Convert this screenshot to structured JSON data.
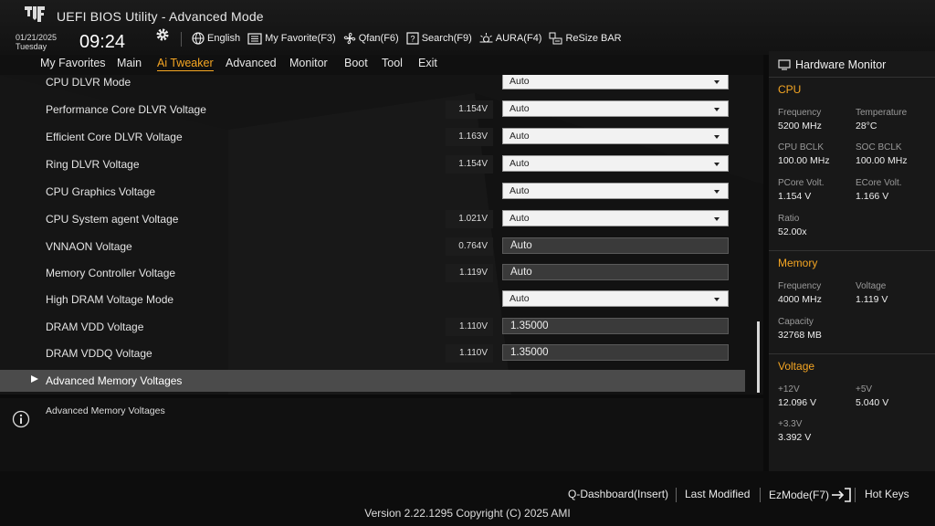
{
  "app": {
    "title": "UEFI BIOS Utility - Advanced Mode",
    "date": "01/21/2025",
    "day": "Tuesday",
    "time": "09:24"
  },
  "toolbar": [
    {
      "label": "English",
      "icon": "globe-icon"
    },
    {
      "label": "My Favorite(F3)",
      "icon": "favorite-icon"
    },
    {
      "label": "Qfan(F6)",
      "icon": "fan-icon"
    },
    {
      "label": "Search(F9)",
      "icon": "search-icon"
    },
    {
      "label": "AURA(F4)",
      "icon": "aura-icon"
    },
    {
      "label": "ReSize BAR",
      "icon": "resize-bar-icon"
    }
  ],
  "menu": [
    {
      "label": "My Favorites",
      "active": false
    },
    {
      "label": "Main",
      "active": false
    },
    {
      "label": "Ai Tweaker",
      "active": true
    },
    {
      "label": "Advanced",
      "active": false
    },
    {
      "label": "Monitor",
      "active": false
    },
    {
      "label": "Boot",
      "active": false
    },
    {
      "label": "Tool",
      "active": false
    },
    {
      "label": "Exit",
      "active": false
    }
  ],
  "settings": [
    {
      "label": "CPU DLVR Mode",
      "value": "",
      "control": "dropdown",
      "setting": "Auto"
    },
    {
      "label": "Performance Core DLVR Voltage",
      "value": "1.154V",
      "control": "dropdown",
      "setting": "Auto"
    },
    {
      "label": "Efficient Core DLVR Voltage",
      "value": "1.163V",
      "control": "dropdown",
      "setting": "Auto"
    },
    {
      "label": "Ring DLVR Voltage",
      "value": "1.154V",
      "control": "dropdown",
      "setting": "Auto"
    },
    {
      "label": "CPU Graphics Voltage",
      "value": "",
      "control": "dropdown",
      "setting": "Auto"
    },
    {
      "label": "CPU System agent Voltage",
      "value": "1.021V",
      "control": "dropdown",
      "setting": "Auto"
    },
    {
      "label": "VNNAON Voltage",
      "value": "0.764V",
      "control": "text",
      "setting": "Auto"
    },
    {
      "label": "Memory Controller Voltage",
      "value": "1.119V",
      "control": "text",
      "setting": "Auto"
    },
    {
      "label": "High DRAM Voltage Mode",
      "value": "",
      "control": "dropdown",
      "setting": "Auto"
    },
    {
      "label": "DRAM VDD Voltage",
      "value": "1.110V",
      "control": "text",
      "setting": "1.35000"
    },
    {
      "label": "DRAM VDDQ Voltage",
      "value": "1.110V",
      "control": "text",
      "setting": "1.35000"
    }
  ],
  "submenu": {
    "label": "Advanced Memory Voltages"
  },
  "help": {
    "text": "Advanced Memory Voltages"
  },
  "hwmon": {
    "title": "Hardware Monitor",
    "cpu": {
      "section": "CPU",
      "frequency_label": "Frequency",
      "frequency": "5200 MHz",
      "temperature_label": "Temperature",
      "temperature": "28°C",
      "bclk_label": "CPU BCLK",
      "bclk": "100.00 MHz",
      "soc_bclk_label": "SOC BCLK",
      "soc_bclk": "100.00 MHz",
      "pcore_label": "PCore Volt.",
      "pcore": "1.154 V",
      "ecore_label": "ECore Volt.",
      "ecore": "1.166 V",
      "ratio_label": "Ratio",
      "ratio": "52.00x"
    },
    "memory": {
      "section": "Memory",
      "frequency_label": "Frequency",
      "frequency": "4000 MHz",
      "voltage_label": "Voltage",
      "voltage": "1.119 V",
      "capacity_label": "Capacity",
      "capacity": "32768 MB"
    },
    "voltage": {
      "section": "Voltage",
      "v12_label": "+12V",
      "v12": "12.096 V",
      "v5_label": "+5V",
      "v5": "5.040 V",
      "v33_label": "+3.3V",
      "v33": "3.392 V"
    }
  },
  "footer": {
    "qdashboard": "Q-Dashboard(Insert)",
    "last_modified": "Last Modified",
    "ezmode": "EzMode(F7)",
    "hotkeys": "Hot Keys",
    "version": "Version 2.22.1295 Copyright (C) 2025 AMI"
  },
  "colors": {
    "accent": "#f5a623",
    "selection": "#4b4b4b"
  }
}
